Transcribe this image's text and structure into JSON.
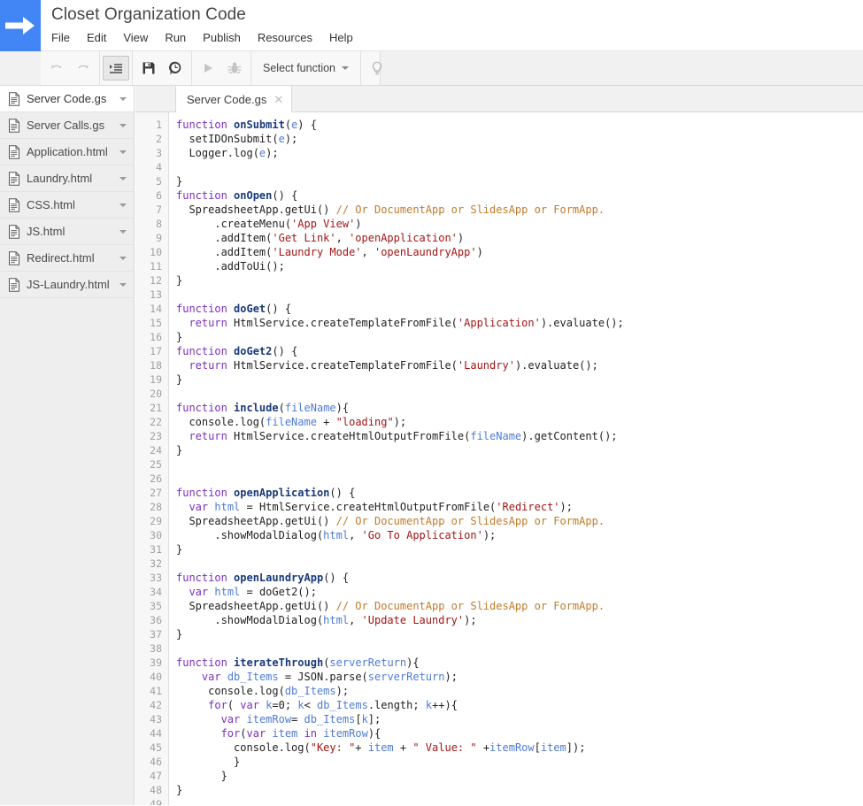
{
  "app": {
    "logo_icon": "arrow-right-icon",
    "title": "Closet Organization Code",
    "accent_color": "#4285f4"
  },
  "menubar": {
    "items": [
      {
        "label": "File"
      },
      {
        "label": "Edit"
      },
      {
        "label": "View"
      },
      {
        "label": "Run"
      },
      {
        "label": "Publish"
      },
      {
        "label": "Resources"
      },
      {
        "label": "Help"
      }
    ]
  },
  "toolbar": {
    "buttons": [
      {
        "name": "undo-icon",
        "title": "Undo",
        "enabled": false
      },
      {
        "name": "redo-icon",
        "title": "Redo",
        "enabled": false
      },
      {
        "name": "indent-icon",
        "title": "Indent",
        "enabled": true,
        "active": true
      },
      {
        "name": "save-icon",
        "title": "Save",
        "enabled": true
      },
      {
        "name": "history-icon",
        "title": "Version history",
        "enabled": true
      },
      {
        "name": "run-icon",
        "title": "Run",
        "enabled": false
      },
      {
        "name": "debug-icon",
        "title": "Debug",
        "enabled": false
      },
      {
        "name": "lightbulb-icon",
        "title": "Suggestions",
        "enabled": true
      }
    ],
    "select_function_label": "Select function"
  },
  "sidebar": {
    "files": [
      {
        "label": "Server Code.gs",
        "selected": true
      },
      {
        "label": "Server Calls.gs",
        "selected": false
      },
      {
        "label": "Application.html",
        "selected": false
      },
      {
        "label": "Laundry.html",
        "selected": false
      },
      {
        "label": "CSS.html",
        "selected": false
      },
      {
        "label": "JS.html",
        "selected": false
      },
      {
        "label": "Redirect.html",
        "selected": false
      },
      {
        "label": "JS-Laundry.html",
        "selected": false
      }
    ]
  },
  "editor": {
    "tabs": [
      {
        "label": "Server Code.gs",
        "close_icon": "close-icon",
        "active": true
      }
    ],
    "code_lines": [
      {
        "n": "1",
        "tokens": [
          {
            "t": "function",
            "c": "k"
          },
          {
            "t": " ",
            "c": "pl"
          },
          {
            "t": "onSubmit",
            "c": "fn"
          },
          {
            "t": "(",
            "c": "pl"
          },
          {
            "t": "e",
            "c": "vr"
          },
          {
            "t": ") {",
            "c": "pl"
          }
        ]
      },
      {
        "n": "2",
        "tokens": [
          {
            "t": "  setIDOnSubmit(",
            "c": "pl"
          },
          {
            "t": "e",
            "c": "vr"
          },
          {
            "t": ");",
            "c": "pl"
          }
        ]
      },
      {
        "n": "3",
        "tokens": [
          {
            "t": "  Logger.log(",
            "c": "pl"
          },
          {
            "t": "e",
            "c": "vr"
          },
          {
            "t": ");",
            "c": "pl"
          }
        ]
      },
      {
        "n": "4",
        "tokens": []
      },
      {
        "n": "5",
        "tokens": [
          {
            "t": "}",
            "c": "pl"
          }
        ]
      },
      {
        "n": "6",
        "tokens": [
          {
            "t": "function",
            "c": "k"
          },
          {
            "t": " ",
            "c": "pl"
          },
          {
            "t": "onOpen",
            "c": "fn"
          },
          {
            "t": "() {",
            "c": "pl"
          }
        ]
      },
      {
        "n": "7",
        "tokens": [
          {
            "t": "  SpreadsheetApp.getUi() ",
            "c": "pl"
          },
          {
            "t": "// Or DocumentApp or SlidesApp or FormApp.",
            "c": "cmt"
          }
        ]
      },
      {
        "n": "8",
        "tokens": [
          {
            "t": "      .createMenu(",
            "c": "pl"
          },
          {
            "t": "'App View'",
            "c": "str"
          },
          {
            "t": ")",
            "c": "pl"
          }
        ]
      },
      {
        "n": "9",
        "tokens": [
          {
            "t": "      .addItem(",
            "c": "pl"
          },
          {
            "t": "'Get Link'",
            "c": "str"
          },
          {
            "t": ", ",
            "c": "pl"
          },
          {
            "t": "'openApplication'",
            "c": "str"
          },
          {
            "t": ")",
            "c": "pl"
          }
        ]
      },
      {
        "n": "10",
        "tokens": [
          {
            "t": "      .addItem(",
            "c": "pl"
          },
          {
            "t": "'Laundry Mode'",
            "c": "str"
          },
          {
            "t": ", ",
            "c": "pl"
          },
          {
            "t": "'openLaundryApp'",
            "c": "str"
          },
          {
            "t": ")",
            "c": "pl"
          }
        ]
      },
      {
        "n": "11",
        "tokens": [
          {
            "t": "      .addToUi();",
            "c": "pl"
          }
        ]
      },
      {
        "n": "12",
        "tokens": [
          {
            "t": "}",
            "c": "pl"
          }
        ]
      },
      {
        "n": "13",
        "tokens": []
      },
      {
        "n": "14",
        "tokens": [
          {
            "t": "function",
            "c": "k"
          },
          {
            "t": " ",
            "c": "pl"
          },
          {
            "t": "doGet",
            "c": "fn"
          },
          {
            "t": "() {",
            "c": "pl"
          }
        ]
      },
      {
        "n": "15",
        "tokens": [
          {
            "t": "  ",
            "c": "pl"
          },
          {
            "t": "return",
            "c": "k"
          },
          {
            "t": " HtmlService.createTemplateFromFile(",
            "c": "pl"
          },
          {
            "t": "'Application'",
            "c": "str"
          },
          {
            "t": ").evaluate();",
            "c": "pl"
          }
        ]
      },
      {
        "n": "16",
        "tokens": [
          {
            "t": "}",
            "c": "pl"
          }
        ]
      },
      {
        "n": "17",
        "tokens": [
          {
            "t": "function",
            "c": "k"
          },
          {
            "t": " ",
            "c": "pl"
          },
          {
            "t": "doGet2",
            "c": "fn"
          },
          {
            "t": "() {",
            "c": "pl"
          }
        ]
      },
      {
        "n": "18",
        "tokens": [
          {
            "t": "  ",
            "c": "pl"
          },
          {
            "t": "return",
            "c": "k"
          },
          {
            "t": " HtmlService.createTemplateFromFile(",
            "c": "pl"
          },
          {
            "t": "'Laundry'",
            "c": "str"
          },
          {
            "t": ").evaluate();",
            "c": "pl"
          }
        ]
      },
      {
        "n": "19",
        "tokens": [
          {
            "t": "}",
            "c": "pl"
          }
        ]
      },
      {
        "n": "20",
        "tokens": []
      },
      {
        "n": "21",
        "tokens": [
          {
            "t": "function",
            "c": "k"
          },
          {
            "t": " ",
            "c": "pl"
          },
          {
            "t": "include",
            "c": "fn"
          },
          {
            "t": "(",
            "c": "pl"
          },
          {
            "t": "fileName",
            "c": "vr"
          },
          {
            "t": "){",
            "c": "pl"
          }
        ]
      },
      {
        "n": "22",
        "tokens": [
          {
            "t": "  console.log(",
            "c": "pl"
          },
          {
            "t": "fileName",
            "c": "vr"
          },
          {
            "t": " + ",
            "c": "pl"
          },
          {
            "t": "\"loading\"",
            "c": "str"
          },
          {
            "t": ");",
            "c": "pl"
          }
        ]
      },
      {
        "n": "23",
        "tokens": [
          {
            "t": "  ",
            "c": "pl"
          },
          {
            "t": "return",
            "c": "k"
          },
          {
            "t": " HtmlService.createHtmlOutputFromFile(",
            "c": "pl"
          },
          {
            "t": "fileName",
            "c": "vr"
          },
          {
            "t": ").getContent();",
            "c": "pl"
          }
        ]
      },
      {
        "n": "24",
        "tokens": [
          {
            "t": "}",
            "c": "pl"
          }
        ]
      },
      {
        "n": "25",
        "tokens": []
      },
      {
        "n": "26",
        "tokens": []
      },
      {
        "n": "27",
        "tokens": [
          {
            "t": "function",
            "c": "k"
          },
          {
            "t": " ",
            "c": "pl"
          },
          {
            "t": "openApplication",
            "c": "fn"
          },
          {
            "t": "() {",
            "c": "pl"
          }
        ]
      },
      {
        "n": "28",
        "tokens": [
          {
            "t": "  ",
            "c": "pl"
          },
          {
            "t": "var",
            "c": "k"
          },
          {
            "t": " ",
            "c": "pl"
          },
          {
            "t": "html",
            "c": "vr"
          },
          {
            "t": " = HtmlService.createHtmlOutputFromFile(",
            "c": "pl"
          },
          {
            "t": "'Redirect'",
            "c": "str"
          },
          {
            "t": ");",
            "c": "pl"
          }
        ]
      },
      {
        "n": "29",
        "tokens": [
          {
            "t": "  SpreadsheetApp.getUi() ",
            "c": "pl"
          },
          {
            "t": "// Or DocumentApp or SlidesApp or FormApp.",
            "c": "cmt"
          }
        ]
      },
      {
        "n": "30",
        "tokens": [
          {
            "t": "      .showModalDialog(",
            "c": "pl"
          },
          {
            "t": "html",
            "c": "vr"
          },
          {
            "t": ", ",
            "c": "pl"
          },
          {
            "t": "'Go To Application'",
            "c": "str"
          },
          {
            "t": ");",
            "c": "pl"
          }
        ]
      },
      {
        "n": "31",
        "tokens": [
          {
            "t": "}",
            "c": "pl"
          }
        ]
      },
      {
        "n": "32",
        "tokens": []
      },
      {
        "n": "33",
        "tokens": [
          {
            "t": "function",
            "c": "k"
          },
          {
            "t": " ",
            "c": "pl"
          },
          {
            "t": "openLaundryApp",
            "c": "fn"
          },
          {
            "t": "() {",
            "c": "pl"
          }
        ]
      },
      {
        "n": "34",
        "tokens": [
          {
            "t": "  ",
            "c": "pl"
          },
          {
            "t": "var",
            "c": "k"
          },
          {
            "t": " ",
            "c": "pl"
          },
          {
            "t": "html",
            "c": "vr"
          },
          {
            "t": " = doGet2();",
            "c": "pl"
          }
        ]
      },
      {
        "n": "35",
        "tokens": [
          {
            "t": "  SpreadsheetApp.getUi() ",
            "c": "pl"
          },
          {
            "t": "// Or DocumentApp or SlidesApp or FormApp.",
            "c": "cmt"
          }
        ]
      },
      {
        "n": "36",
        "tokens": [
          {
            "t": "      .showModalDialog(",
            "c": "pl"
          },
          {
            "t": "html",
            "c": "vr"
          },
          {
            "t": ", ",
            "c": "pl"
          },
          {
            "t": "'Update Laundry'",
            "c": "str"
          },
          {
            "t": ");",
            "c": "pl"
          }
        ]
      },
      {
        "n": "37",
        "tokens": [
          {
            "t": "}",
            "c": "pl"
          }
        ]
      },
      {
        "n": "38",
        "tokens": []
      },
      {
        "n": "39",
        "tokens": [
          {
            "t": "function",
            "c": "k"
          },
          {
            "t": " ",
            "c": "pl"
          },
          {
            "t": "iterateThrough",
            "c": "fn"
          },
          {
            "t": "(",
            "c": "pl"
          },
          {
            "t": "serverReturn",
            "c": "vr"
          },
          {
            "t": "){",
            "c": "pl"
          }
        ]
      },
      {
        "n": "40",
        "tokens": [
          {
            "t": "    ",
            "c": "pl"
          },
          {
            "t": "var",
            "c": "k"
          },
          {
            "t": " ",
            "c": "pl"
          },
          {
            "t": "db_Items",
            "c": "vr"
          },
          {
            "t": " = JSON.parse(",
            "c": "pl"
          },
          {
            "t": "serverReturn",
            "c": "vr"
          },
          {
            "t": ");",
            "c": "pl"
          }
        ]
      },
      {
        "n": "41",
        "tokens": [
          {
            "t": "     console.log(",
            "c": "pl"
          },
          {
            "t": "db_Items",
            "c": "vr"
          },
          {
            "t": ");",
            "c": "pl"
          }
        ]
      },
      {
        "n": "42",
        "tokens": [
          {
            "t": "     ",
            "c": "pl"
          },
          {
            "t": "for",
            "c": "k"
          },
          {
            "t": "( ",
            "c": "pl"
          },
          {
            "t": "var",
            "c": "k"
          },
          {
            "t": " ",
            "c": "pl"
          },
          {
            "t": "k",
            "c": "vr"
          },
          {
            "t": "=0; ",
            "c": "pl"
          },
          {
            "t": "k",
            "c": "vr"
          },
          {
            "t": "< ",
            "c": "pl"
          },
          {
            "t": "db_Items",
            "c": "vr"
          },
          {
            "t": ".length; ",
            "c": "pl"
          },
          {
            "t": "k",
            "c": "vr"
          },
          {
            "t": "++){",
            "c": "pl"
          }
        ]
      },
      {
        "n": "43",
        "tokens": [
          {
            "t": "       ",
            "c": "pl"
          },
          {
            "t": "var",
            "c": "k"
          },
          {
            "t": " ",
            "c": "pl"
          },
          {
            "t": "itemRow",
            "c": "vr"
          },
          {
            "t": "= ",
            "c": "pl"
          },
          {
            "t": "db_Items",
            "c": "vr"
          },
          {
            "t": "[",
            "c": "pl"
          },
          {
            "t": "k",
            "c": "vr"
          },
          {
            "t": "];",
            "c": "pl"
          }
        ]
      },
      {
        "n": "44",
        "tokens": [
          {
            "t": "       ",
            "c": "pl"
          },
          {
            "t": "for",
            "c": "k"
          },
          {
            "t": "(",
            "c": "pl"
          },
          {
            "t": "var",
            "c": "k"
          },
          {
            "t": " ",
            "c": "pl"
          },
          {
            "t": "item",
            "c": "vr"
          },
          {
            "t": " ",
            "c": "pl"
          },
          {
            "t": "in",
            "c": "k"
          },
          {
            "t": " ",
            "c": "pl"
          },
          {
            "t": "itemRow",
            "c": "vr"
          },
          {
            "t": "){",
            "c": "pl"
          }
        ]
      },
      {
        "n": "45",
        "tokens": [
          {
            "t": "         console.log(",
            "c": "pl"
          },
          {
            "t": "\"Key: \"",
            "c": "str"
          },
          {
            "t": "+ ",
            "c": "pl"
          },
          {
            "t": "item",
            "c": "vr"
          },
          {
            "t": " + ",
            "c": "pl"
          },
          {
            "t": "\" Value: \"",
            "c": "str"
          },
          {
            "t": " +",
            "c": "pl"
          },
          {
            "t": "itemRow",
            "c": "vr"
          },
          {
            "t": "[",
            "c": "pl"
          },
          {
            "t": "item",
            "c": "vr"
          },
          {
            "t": "]);",
            "c": "pl"
          }
        ]
      },
      {
        "n": "46",
        "tokens": [
          {
            "t": "         }",
            "c": "pl"
          }
        ]
      },
      {
        "n": "47",
        "tokens": [
          {
            "t": "       }",
            "c": "pl"
          }
        ]
      },
      {
        "n": "48",
        "tokens": [
          {
            "t": "}",
            "c": "pl"
          }
        ]
      },
      {
        "n": "49",
        "tokens": []
      }
    ]
  }
}
